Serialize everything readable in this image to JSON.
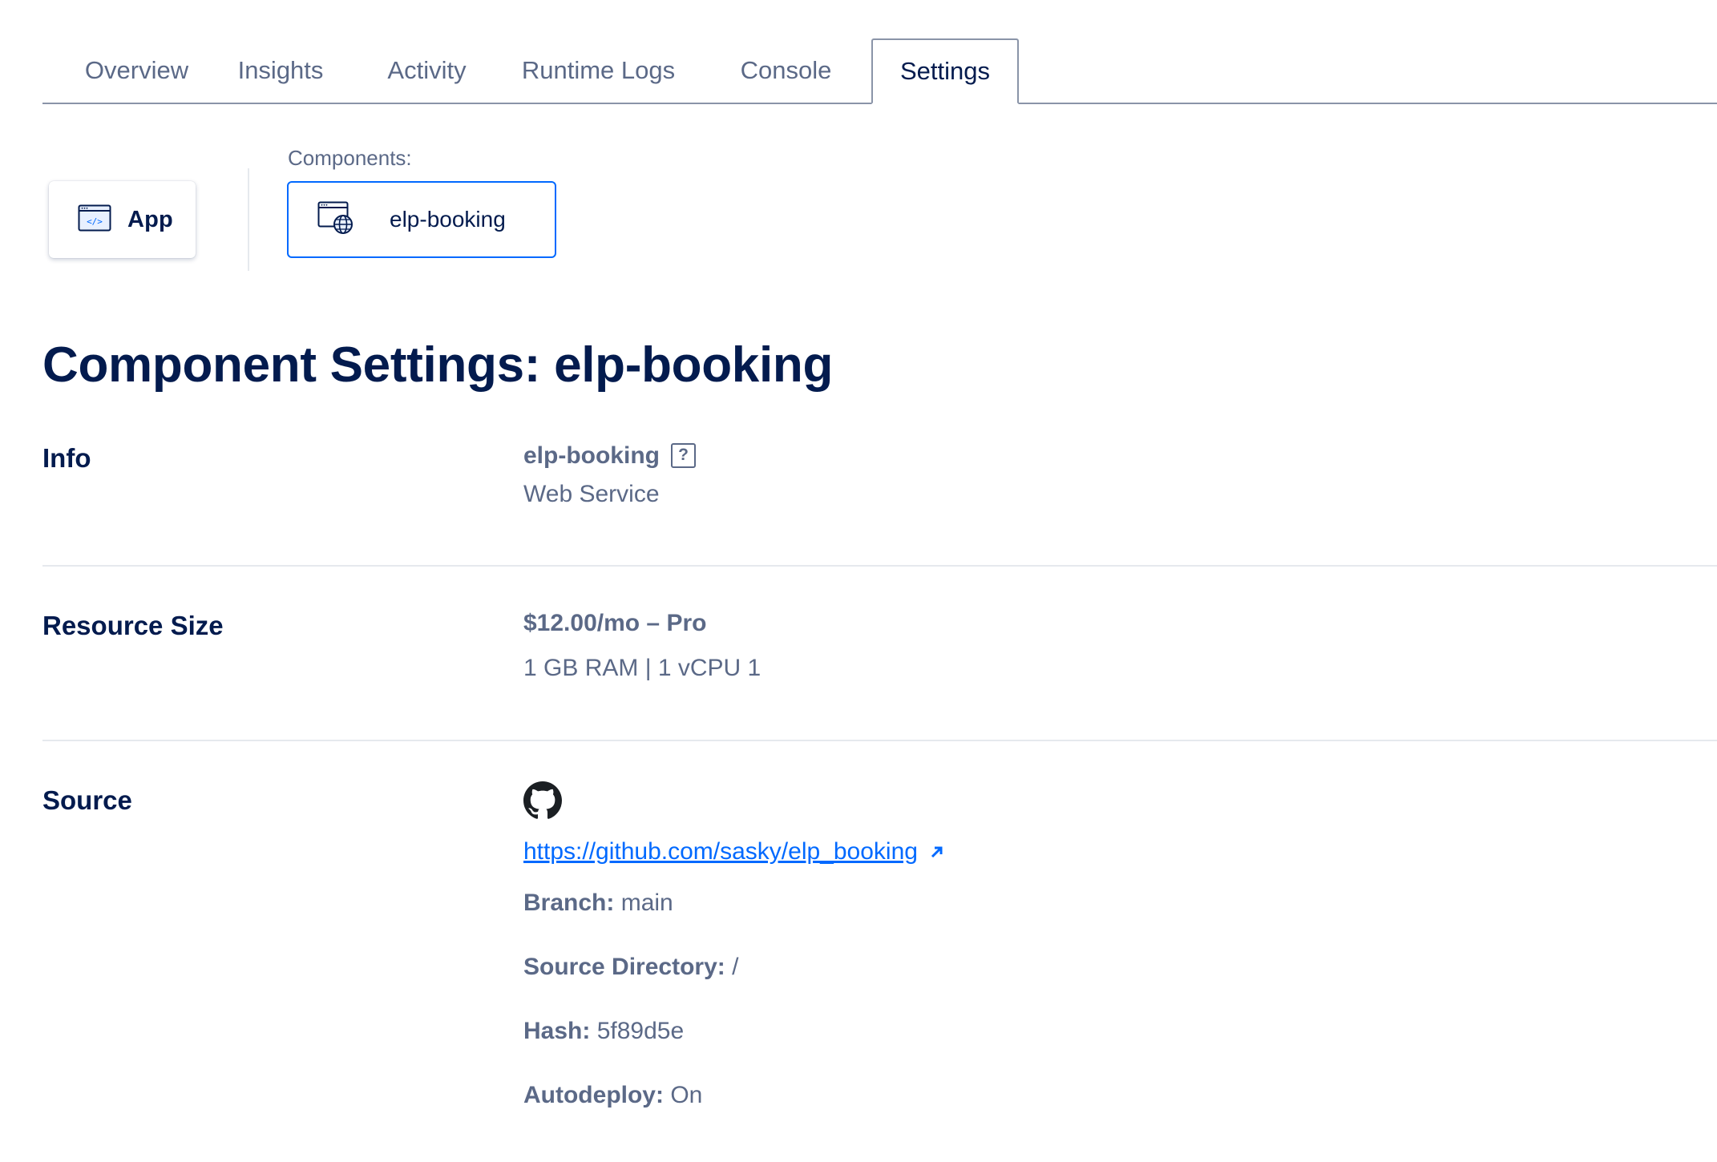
{
  "tabs": [
    {
      "label": "Overview"
    },
    {
      "label": "Insights"
    },
    {
      "label": "Activity"
    },
    {
      "label": "Runtime Logs"
    },
    {
      "label": "Console"
    },
    {
      "label": "Settings",
      "active": true
    }
  ],
  "selector": {
    "app_label": "App",
    "components_label": "Components:",
    "component_name": "elp-booking"
  },
  "page_title": "Component Settings: elp-booking",
  "info": {
    "label": "Info",
    "name": "elp-booking",
    "help_icon": "?",
    "type": "Web Service"
  },
  "resource": {
    "label": "Resource Size",
    "price": "$12.00/mo – Pro",
    "specs": "1 GB RAM | 1 vCPU 1"
  },
  "source": {
    "label": "Source",
    "icon": "github-icon",
    "repo_url": "https://github.com/sasky/elp_booking",
    "branch_label": "Branch:",
    "branch_value": "main",
    "dir_label": "Source Directory:",
    "dir_value": "/",
    "hash_label": "Hash:",
    "hash_value": "5f89d5e",
    "autodeploy_label": "Autodeploy:",
    "autodeploy_value": "On"
  },
  "colors": {
    "primary_text": "#031b4e",
    "secondary_text": "#5b6987",
    "accent": "#0069ff"
  }
}
